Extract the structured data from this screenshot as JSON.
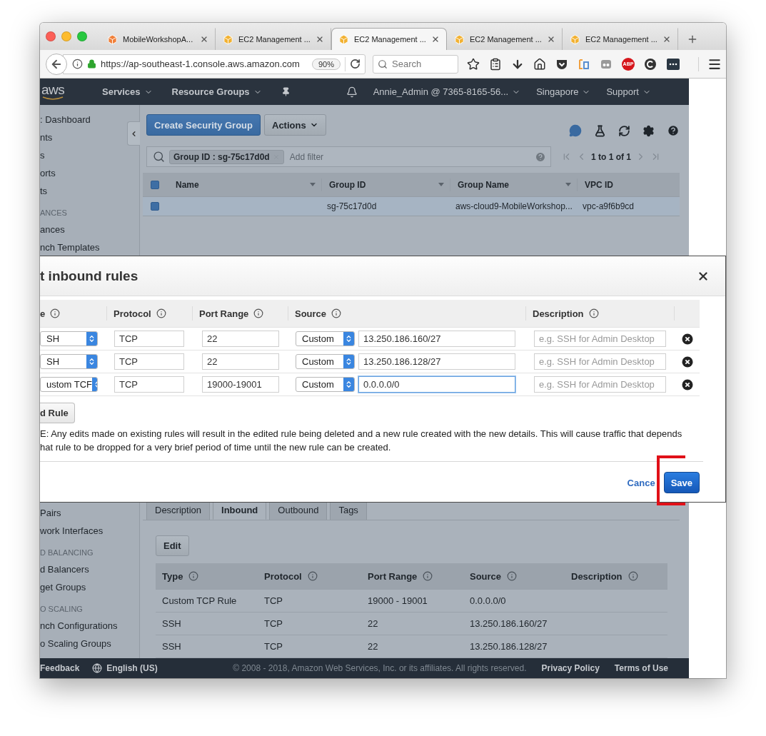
{
  "browser": {
    "tabs": [
      {
        "label": "MobileWorkshopA...",
        "selected": false
      },
      {
        "label": "EC2 Management ...",
        "selected": false
      },
      {
        "label": "EC2 Management ...",
        "selected": true
      },
      {
        "label": "EC2 Management ...",
        "selected": false
      },
      {
        "label": "EC2 Management ...",
        "selected": false
      }
    ],
    "url": "https://ap-southeast-1.console.aws.amazon.com",
    "zoom": "90%",
    "search": {
      "placeholder": "Search"
    },
    "adblock_badge": "ABP"
  },
  "aws_header": {
    "logo": "aws",
    "menus": [
      "Services",
      "Resource Groups"
    ],
    "account": "Annie_Admin @ 7365-8165-56...",
    "region": "Singapore",
    "support": "Support"
  },
  "sidebar": {
    "top_items": [
      {
        "label": ": Dashboard",
        "kind": "link"
      },
      {
        "label": "nts",
        "kind": "link"
      },
      {
        "label": "s",
        "kind": "link"
      },
      {
        "label": "orts",
        "kind": "link"
      },
      {
        "label": "ts",
        "kind": "link"
      },
      {
        "label": "ANCES",
        "kind": "section"
      },
      {
        "label": "ances",
        "kind": "link"
      },
      {
        "label": "nch Templates",
        "kind": "link"
      }
    ],
    "bottom_items": [
      {
        "label": "Pairs",
        "kind": "link"
      },
      {
        "label": "work Interfaces",
        "kind": "link"
      },
      {
        "label": "D BALANCING",
        "kind": "section"
      },
      {
        "label": "d Balancers",
        "kind": "link"
      },
      {
        "label": "get Groups",
        "kind": "link"
      },
      {
        "label": "O SCALING",
        "kind": "section"
      },
      {
        "label": "nch Configurations",
        "kind": "link"
      },
      {
        "label": "o Scaling Groups",
        "kind": "link"
      }
    ]
  },
  "toolbar": {
    "create_button": "Create Security Group",
    "actions_button": "Actions"
  },
  "filter": {
    "tag": "Group ID : sg-75c17d0d",
    "placeholder": "Add filter",
    "pagination": "1 to 1 of 1"
  },
  "groups_table": {
    "header_checked": true,
    "columns": [
      "Name",
      "Group ID",
      "Group Name",
      "VPC ID"
    ],
    "rows": [
      {
        "selected": true,
        "group_id": "sg-75c17d0d",
        "group_name": "aws-cloud9-MobileWorkshop...",
        "vpc_id": "vpc-a9f6b9cd"
      }
    ]
  },
  "dialog": {
    "title": "t inbound rules",
    "columns": [
      "e",
      "Protocol",
      "Port Range",
      "Source",
      "Description"
    ],
    "rules": [
      {
        "type": "SH",
        "protocol": "TCP",
        "port_range": "22",
        "source_kind": "Custom",
        "source": "13.250.186.160/27",
        "description_placeholder": "e.g. SSH for Admin Desktop",
        "focused": false
      },
      {
        "type": "SH",
        "protocol": "TCP",
        "port_range": "22",
        "source_kind": "Custom",
        "source": "13.250.186.128/27",
        "description_placeholder": "e.g. SSH for Admin Desktop",
        "focused": false
      },
      {
        "type": "ustom TCF",
        "protocol": "TCP",
        "port_range": "19000-19001",
        "source_kind": "Custom",
        "source": "0.0.0.0/0",
        "description_placeholder": "e.g. SSH for Admin Desktop",
        "focused": true
      }
    ],
    "add_rule_button": "d Rule",
    "note_lines": [
      "E: Any edits made on existing rules will result in the edited rule being deleted and a new rule created with the new details. This will cause traffic that depends",
      "hat rule to be dropped for a very brief period of time until the new rule can be created."
    ],
    "cancel": "Cance",
    "save": "Save",
    "save_highlighted": true
  },
  "details": {
    "tabs": [
      {
        "label": "Description",
        "selected": false
      },
      {
        "label": "Inbound",
        "selected": true
      },
      {
        "label": "Outbound",
        "selected": false
      },
      {
        "label": "Tags",
        "selected": false
      }
    ],
    "edit_button": "Edit",
    "columns": [
      "Type",
      "Protocol",
      "Port Range",
      "Source",
      "Description"
    ],
    "rows": [
      {
        "type": "Custom TCP Rule",
        "protocol": "TCP",
        "port_range": "19000 - 19001",
        "source": "0.0.0.0/0"
      },
      {
        "type": "SSH",
        "protocol": "TCP",
        "port_range": "22",
        "source": "13.250.186.160/27"
      },
      {
        "type": "SSH",
        "protocol": "TCP",
        "port_range": "22",
        "source": "13.250.186.128/27"
      }
    ]
  },
  "footer": {
    "feedback": "Feedback",
    "language": "English (US)",
    "copyright": "© 2008 - 2018, Amazon Web Services, Inc. or its affiliates. All rights reserved.",
    "links": [
      "Privacy Policy",
      "Terms of Use"
    ]
  }
}
